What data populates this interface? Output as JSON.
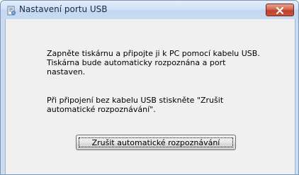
{
  "window": {
    "title": "Nastavení portu USB",
    "title_icon": "printer-setup-icon",
    "close_icon": "close-icon",
    "close_color": "#c9523a"
  },
  "content": {
    "message_lines": [
      "Zapněte tiskárnu a připojte ji k PC pomocí kabelu USB.",
      "Tiskárna bude automaticky rozpoznána a port",
      "nastaven."
    ],
    "hint_lines": [
      "Při připojení bez kabelu USB stiskněte \"Zrušit",
      "automatické rozpoznávání\"."
    ]
  },
  "buttons": {
    "cancel_label": "Zrušit automatické rozpoznávání"
  }
}
